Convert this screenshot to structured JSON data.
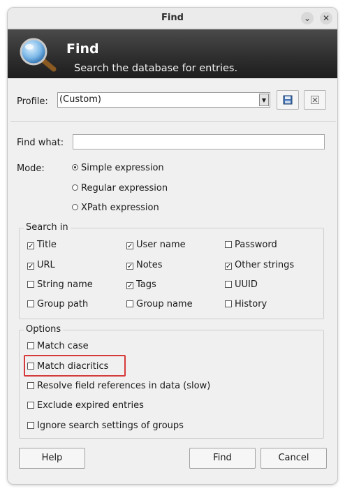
{
  "window": {
    "title": "Find",
    "minimize_glyph": "⌄",
    "close_glyph": "✕"
  },
  "banner": {
    "title": "Find",
    "subtitle": "Search the database for entries.",
    "icon": "magnifier-icon"
  },
  "profile": {
    "label": "Profile:",
    "value": "(Custom)",
    "save_icon": "save-profile-icon",
    "delete_icon": "delete-profile-icon"
  },
  "find_what": {
    "label": "Find what:",
    "value": ""
  },
  "mode": {
    "label": "Mode:",
    "options": [
      {
        "label": "Simple expression",
        "selected": true
      },
      {
        "label": "Regular expression",
        "selected": false
      },
      {
        "label": "XPath expression",
        "selected": false
      }
    ]
  },
  "search_in": {
    "legend": "Search in",
    "items": [
      {
        "label": "Title",
        "checked": true
      },
      {
        "label": "User name",
        "checked": true
      },
      {
        "label": "Password",
        "checked": false
      },
      {
        "label": "URL",
        "checked": true
      },
      {
        "label": "Notes",
        "checked": true
      },
      {
        "label": "Other strings",
        "checked": true
      },
      {
        "label": "String name",
        "checked": false
      },
      {
        "label": "Tags",
        "checked": true
      },
      {
        "label": "UUID",
        "checked": false
      },
      {
        "label": "Group path",
        "checked": false
      },
      {
        "label": "Group name",
        "checked": false
      },
      {
        "label": "History",
        "checked": false
      }
    ]
  },
  "options": {
    "legend": "Options",
    "items": [
      {
        "label": "Match case",
        "checked": false
      },
      {
        "label": "Match diacritics",
        "checked": false
      },
      {
        "label": "Resolve field references in data (slow)",
        "checked": false
      },
      {
        "label": "Exclude expired entries",
        "checked": false
      },
      {
        "label": "Ignore search settings of groups",
        "checked": false
      }
    ]
  },
  "buttons": {
    "help": "Help",
    "find": "Find",
    "cancel": "Cancel"
  },
  "colors": {
    "highlight": "#d73a3a",
    "banner_dark": "#1e1e1e"
  }
}
